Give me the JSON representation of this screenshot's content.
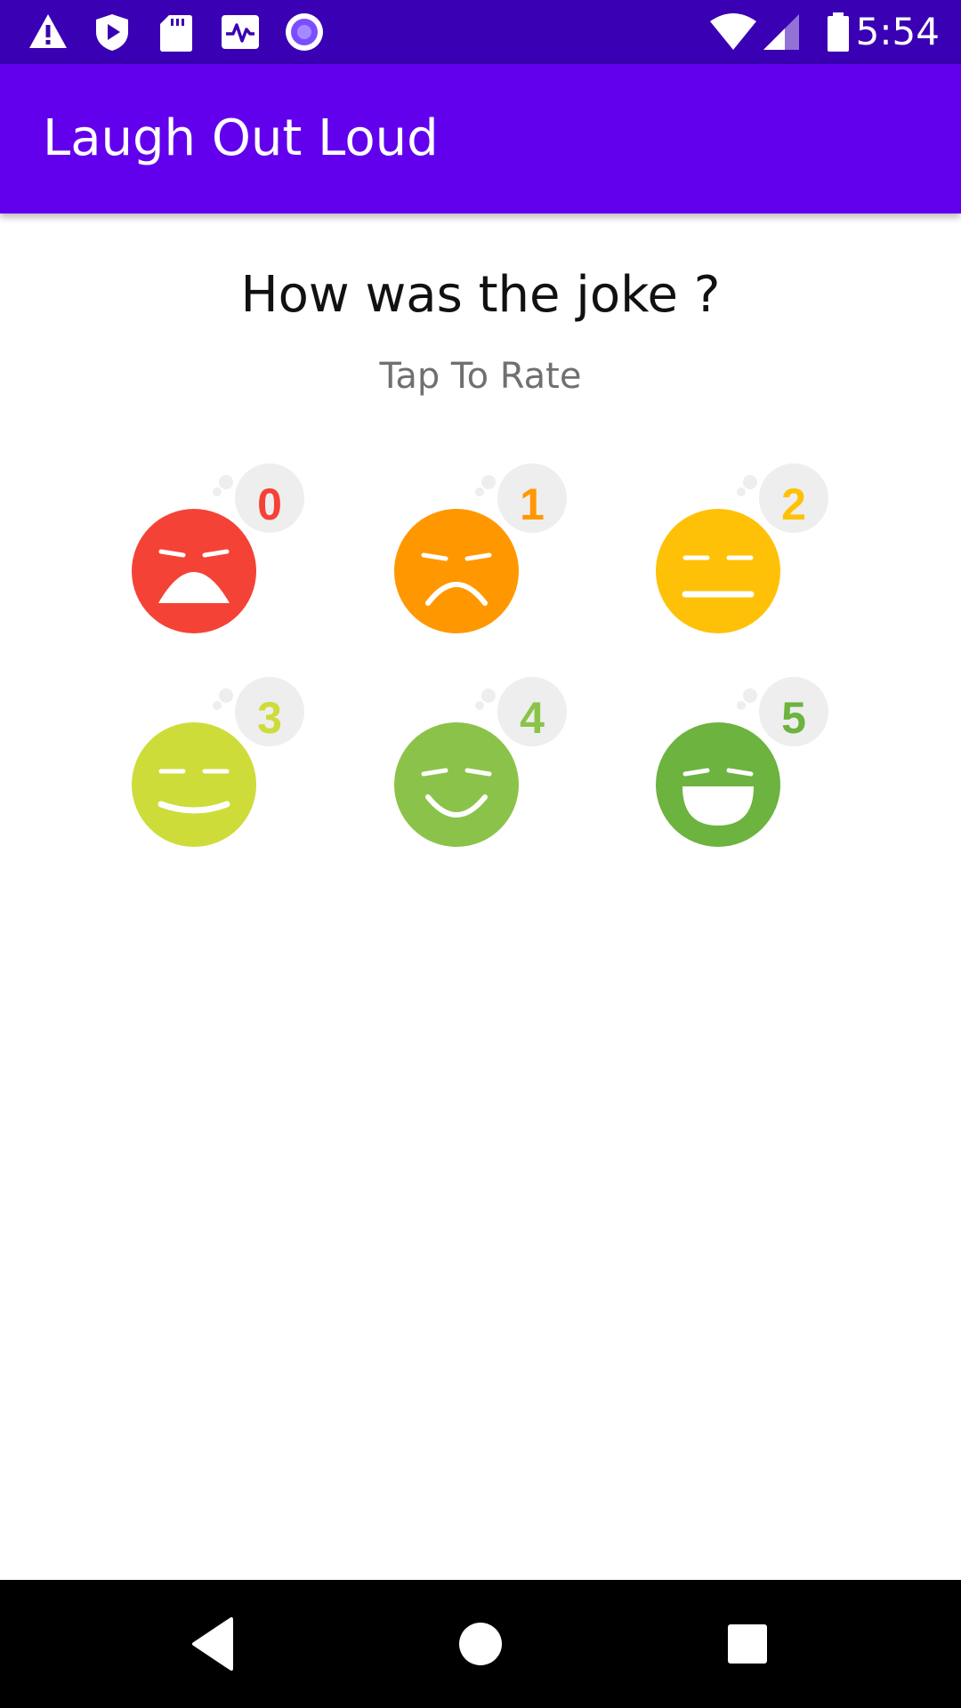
{
  "status_bar": {
    "time": "5:54",
    "left_icons": [
      "warning-icon",
      "play-shield-icon",
      "sd-card-icon",
      "activity-monitor-icon",
      "record-icon"
    ],
    "right_icons": [
      "wifi-icon",
      "cell-signal-icon",
      "battery-icon"
    ],
    "background": "#3a00b3"
  },
  "app_bar": {
    "title": "Laugh Out Loud",
    "background": "#6200ee"
  },
  "main": {
    "question": "How was the joke ?",
    "subtitle": "Tap To Rate",
    "ratings": [
      {
        "value": "0",
        "face": "crying",
        "color": "#f44336",
        "number_color": "#f44336"
      },
      {
        "value": "1",
        "face": "sad",
        "color": "#ff9800",
        "number_color": "#ff9800"
      },
      {
        "value": "2",
        "face": "neutral",
        "color": "#ffc107",
        "number_color": "#ffc107"
      },
      {
        "value": "3",
        "face": "slight-smile",
        "color": "#cddc39",
        "number_color": "#cddc39"
      },
      {
        "value": "4",
        "face": "smile",
        "color": "#8bc34a",
        "number_color": "#8bc34a"
      },
      {
        "value": "5",
        "face": "laugh",
        "color": "#6db33f",
        "number_color": "#6db33f"
      }
    ]
  },
  "nav_bar": {
    "icons": [
      "back-icon",
      "home-icon",
      "recents-icon"
    ]
  }
}
